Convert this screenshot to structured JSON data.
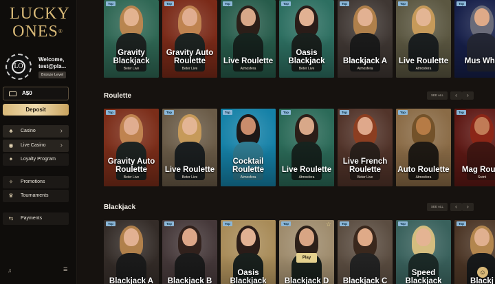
{
  "sidebar": {
    "brand": [
      "LUCKY",
      "ONES"
    ],
    "trademark": "®",
    "avatar_letter": "LO",
    "welcome": "Welcome,",
    "email": "test@pla...",
    "level": "Bronze Level",
    "balance": "A$0",
    "deposit": "Deposit",
    "items": [
      {
        "label": "Casino",
        "icon": "casino-icon",
        "arrow": "›"
      },
      {
        "label": "Live Casino",
        "icon": "live-casino-icon",
        "arrow": "›"
      },
      {
        "label": "Loyalty Program",
        "icon": "loyalty-icon"
      },
      {
        "label": "Promotions",
        "icon": "promotions-icon"
      },
      {
        "label": "Tournaments",
        "icon": "tournaments-icon"
      },
      {
        "label": "Payments",
        "icon": "payments-icon"
      }
    ]
  },
  "sections": [
    {
      "title": "Roulette",
      "seeall": "SEE ALL",
      "prev": "‹",
      "next": "›",
      "cards": [
        {
          "title": "Gravity Auto Roulette",
          "provider": "Beter Live",
          "badge": "Top",
          "bg": "#7b2d19",
          "skin": "#e0ad90",
          "hair": "#bf8350",
          "body": "#1d2321"
        },
        {
          "title": "Live Roulette",
          "provider": "Beter Live",
          "badge": "Top",
          "bg": "#6a5b47",
          "skin": "#e3b594",
          "hair": "#c69a5a",
          "body": "#1b1f20"
        },
        {
          "title": "Cocktail Roulette",
          "provider": "Atmosfera",
          "badge": "Top",
          "bg": "#1581a7",
          "skin": "#c98c6c",
          "hair": "#1d1817",
          "body": "#2f7b91"
        },
        {
          "title": "Live Roulette",
          "provider": "Atmosfera",
          "badge": "Top",
          "bg": "#2b6a58",
          "skin": "#d8a889",
          "hair": "#2b1e18",
          "body": "#16231e"
        },
        {
          "title": "Live French Roulette",
          "provider": "Beter Live",
          "badge": "Top",
          "bg": "#52342a",
          "skin": "#dfa88b",
          "hair": "#8c3e21",
          "body": "#2a201b"
        },
        {
          "title": "Auto Roulette",
          "provider": "Atmosfera",
          "badge": "Top",
          "bg": "#8a6b46",
          "skin": "#b67b45",
          "hair": "#73522a",
          "body": "#1f1a14"
        },
        {
          "title": "Mag Roule",
          "provider": "Swint",
          "badge": "Top",
          "bg": "#5d1814",
          "skin": "#c17b56",
          "hair": "#8b2617",
          "body": "#411612"
        }
      ]
    },
    {
      "title": "Blackjack",
      "seeall": "SEE ALL",
      "prev": "‹",
      "next": "›",
      "cards": [
        {
          "title": "Blackjack A",
          "provider": "",
          "badge": "Top",
          "bg": "#342c28",
          "skin": "#e2b192",
          "hair": "#b0804b",
          "body": "#1b1b1b"
        },
        {
          "title": "Blackjack B",
          "provider": "",
          "badge": "Top",
          "bg": "#453839",
          "skin": "#dca688",
          "hair": "#31211c",
          "body": "#1b1b1b"
        },
        {
          "title": "Oasis Blackjack",
          "provider": "",
          "badge": "Top",
          "bg": "#a88b58",
          "skin": "#e1b193",
          "hair": "#2a1c18",
          "body": "#19201d"
        },
        {
          "title": "Blackjack D",
          "provider": "",
          "badge": "Top",
          "bg": "#9e8b6c",
          "skin": "#d8a584",
          "hair": "#2c2019",
          "body": "#18201b",
          "play": "Play",
          "star": "☆"
        },
        {
          "title": "Blackjack C",
          "provider": "",
          "badge": "Top",
          "bg": "#5b4d41",
          "skin": "#dfaa88",
          "hair": "#3a281d",
          "body": "#232323"
        },
        {
          "title": "Speed Blackjack",
          "provider": "",
          "badge": "Top",
          "bg": "#39615c",
          "skin": "#e4b493",
          "hair": "#d4bd7f",
          "body": "#1c2b28"
        },
        {
          "title": "Blackj",
          "provider": "",
          "badge": "Top",
          "bg": "#4b3525",
          "skin": "#e0b08f",
          "hair": "#b3864e",
          "body": "#17191a"
        }
      ]
    }
  ],
  "top_row": [
    {
      "title": "Gravity Blackjack",
      "provider": "Beter Live",
      "badge": "Top",
      "bg": "#2f6754",
      "skin": "#e3b390",
      "hair": "#b88550",
      "body": "#1c2220"
    },
    {
      "title": "Gravity Auto Roulette",
      "provider": "Beter Live",
      "badge": "Top",
      "bg": "#7a2a18",
      "skin": "#e0ad90",
      "hair": "#bf8350",
      "body": "#1d2321"
    },
    {
      "title": "Live Roulette",
      "provider": "Atmosfera",
      "badge": "Top",
      "bg": "#275c4b",
      "skin": "#d8a889",
      "hair": "#2b1e18",
      "body": "#16231e"
    },
    {
      "title": "Oasis Blackjack",
      "provider": "Beter Live",
      "badge": "Top",
      "bg": "#2d6f61",
      "skin": "#e1b193",
      "hair": "#2a1c18",
      "body": "#19201d"
    },
    {
      "title": "Blackjack A",
      "provider": "Atmosfera",
      "badge": "Top",
      "bg": "#3f3733",
      "skin": "#e2b192",
      "hair": "#b0804b",
      "body": "#1b1b1b"
    },
    {
      "title": "Live Roulette",
      "provider": "Atmosfera",
      "badge": "Top",
      "bg": "#5b5741",
      "skin": "#e3b594",
      "hair": "#c69a5a",
      "body": "#1b1f20"
    },
    {
      "title": "Mus Whe",
      "provider": "",
      "badge": "Top",
      "bg": "#161f49",
      "skin": "#dfaa88",
      "hair": "#6a6b79",
      "body": "#242735"
    }
  ],
  "chat_icon": "☺"
}
